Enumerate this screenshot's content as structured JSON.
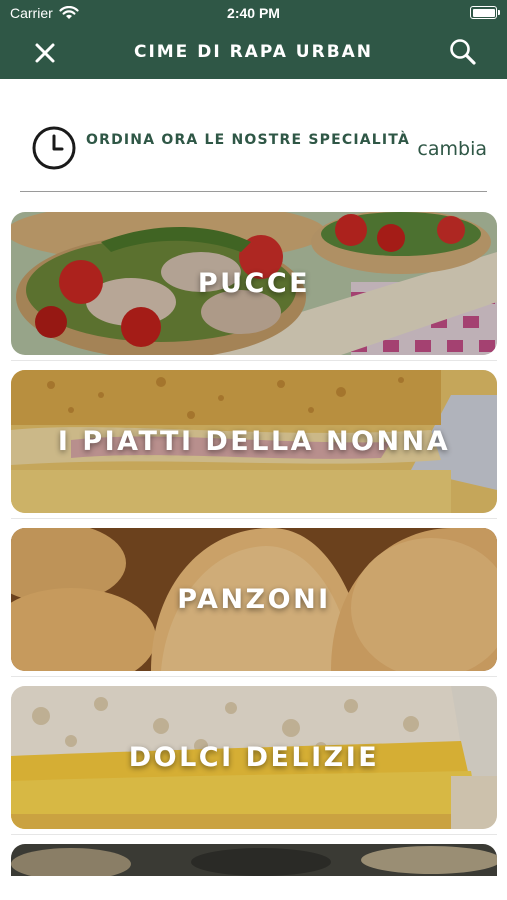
{
  "status_bar": {
    "carrier": "Carrier",
    "time": "2:40 PM"
  },
  "header": {
    "title": "CIME DI RAPA URBAN"
  },
  "order": {
    "text": "ORDINA ORA LE NOSTRE SPECIALITÀ",
    "change_label": "cambia"
  },
  "categories": [
    {
      "label": "PUCCE"
    },
    {
      "label": "I PIATTI DELLA NONNA"
    },
    {
      "label": "PANZONI"
    },
    {
      "label": "DOLCI DELIZIE"
    }
  ],
  "colors": {
    "brand": "#2f5746",
    "background": "#ffffff"
  },
  "icons": [
    "close-icon",
    "search-icon",
    "clock-icon",
    "wifi-icon",
    "battery-icon"
  ]
}
